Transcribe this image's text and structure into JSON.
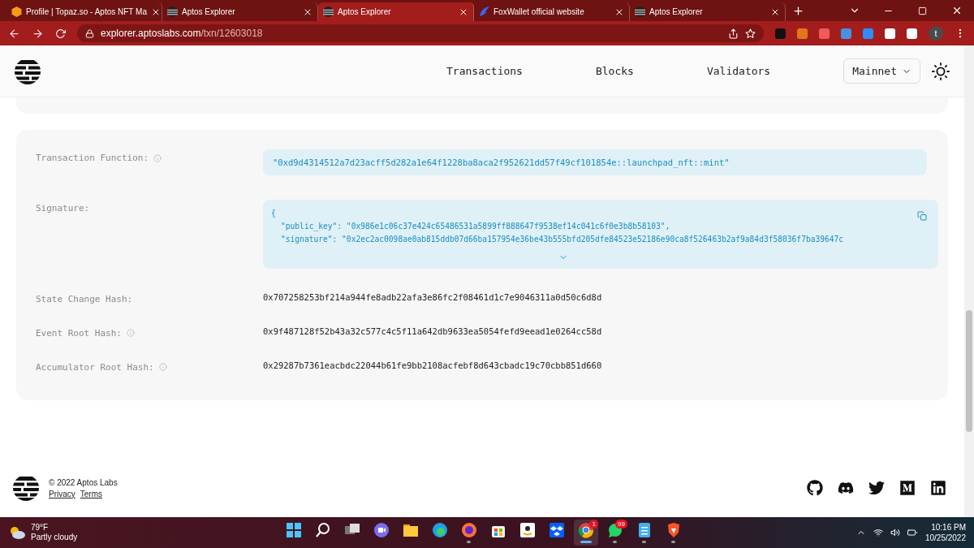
{
  "browser": {
    "tabs": [
      {
        "title": "Profile | Topaz.so - Aptos NFT Ma",
        "kind": "topaz",
        "selected": false
      },
      {
        "title": "Aptos Explorer",
        "kind": "aptos",
        "selected": false
      },
      {
        "title": "Aptos Explorer",
        "kind": "aptos",
        "selected": true
      },
      {
        "title": "FoxWallet official website",
        "kind": "fox",
        "selected": false
      },
      {
        "title": "Aptos Explorer",
        "kind": "aptos",
        "selected": false
      }
    ],
    "url_host": "explorer.aptoslabs.com",
    "url_path": "/txn/12603018",
    "profile_initial": "t"
  },
  "header": {
    "nav": [
      "Transactions",
      "Blocks",
      "Validators"
    ],
    "network": "Mainnet"
  },
  "details": [
    {
      "label": "Transaction Function:",
      "info": true,
      "kind": "code",
      "value": "\"0xd9d4314512a7d23acff5d282a1e64f1228ba8aca2f952621dd57f49cf101854e::launchpad_nft::mint\""
    },
    {
      "label": "Signature:",
      "info": false,
      "kind": "json",
      "lines": [
        "{",
        "\"public_key\": \"0x986e1c06c37e424c65486531a5899ff888647f9538ef14c041c6f0e3b8b58103\",",
        "\"signature\": \"0x2ec2ac0098ae0ab815ddb07d66ba157954e36be43b555bfd205dfe84523e52186e90ca8f526463b2af9a84d3f58036f7ba39647c"
      ]
    },
    {
      "label": "State Change Hash:",
      "info": false,
      "kind": "plain",
      "value": "0x707258253bf214a944fe8adb22afa3e86fc2f08461d1c7e9046311a0d50c6d8d"
    },
    {
      "label": "Event Root Hash:",
      "info": true,
      "kind": "plain",
      "value": "0x9f487128f52b43a32c577c4c5f11a642db9633ea5054fefd9eead1e0264cc58d"
    },
    {
      "label": "Accumulator Root Hash:",
      "info": true,
      "kind": "plain",
      "value": "0x29287b7361eacbdc22044b61fe9bb2108acfebf8d643cbadc19c70cbb851d660"
    }
  ],
  "footer": {
    "copyright": "© 2022 Aptos Labs",
    "links": [
      "Privacy",
      "Terms"
    ]
  },
  "taskbar": {
    "temperature": "79°F",
    "weather": "Partly cloudy",
    "time": "10:16 PM",
    "date": "10/25/2022",
    "apps": [
      {
        "kind": "start",
        "running": false,
        "selected": false
      },
      {
        "kind": "search",
        "running": false,
        "selected": false
      },
      {
        "kind": "taskview",
        "running": false,
        "selected": false
      },
      {
        "kind": "chat",
        "running": false,
        "selected": false
      },
      {
        "kind": "folder",
        "running": false,
        "selected": false
      },
      {
        "kind": "edge",
        "running": false,
        "selected": false
      },
      {
        "kind": "firefox",
        "running": true,
        "selected": false
      },
      {
        "kind": "store",
        "running": false,
        "selected": false
      },
      {
        "kind": "amazon",
        "running": false,
        "selected": false
      },
      {
        "kind": "dropbox",
        "running": false,
        "selected": false
      },
      {
        "kind": "chrome",
        "running": true,
        "selected": true,
        "badge": "1"
      },
      {
        "kind": "whatsapp",
        "running": true,
        "selected": false,
        "badge": "99"
      },
      {
        "kind": "notepad",
        "running": true,
        "selected": false
      },
      {
        "kind": "brave",
        "running": true,
        "selected": false
      }
    ]
  }
}
